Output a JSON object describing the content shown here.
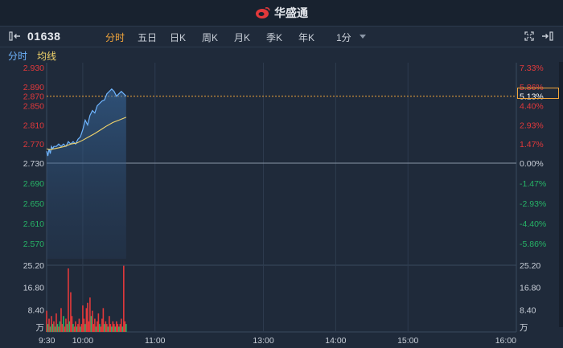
{
  "brand": {
    "name": "华盛通"
  },
  "toolbar": {
    "code": "01638",
    "tabs": [
      "分时",
      "五日",
      "日K",
      "周K",
      "月K",
      "季K",
      "年K",
      "1分"
    ],
    "active_tab": 0
  },
  "legend": {
    "time_label": "分时",
    "avg_label": "均线"
  },
  "colors": {
    "up": "#e2393b",
    "down": "#27b467",
    "price_line": "#6fb5ff",
    "avg_line": "#f2d46b",
    "accent": "#f2a53b",
    "baseline": "#8a96a6"
  },
  "chart_data": {
    "type": "line",
    "prev_close": 2.73,
    "price_ticks_up": [
      "2.930",
      "2.890",
      "2.850",
      "2.810",
      "2.770"
    ],
    "price_tick_base": "2.730",
    "price_ticks_down": [
      "2.690",
      "2.650",
      "2.610",
      "2.570"
    ],
    "pct_ticks_up": [
      "7.33%",
      "5.86%",
      "4.40%",
      "2.93%",
      "1.47%"
    ],
    "pct_tick_base": "0.00%",
    "pct_ticks_down": [
      "-1.47%",
      "-2.93%",
      "-4.40%",
      "-5.86%"
    ],
    "ylim": [
      2.53,
      2.93
    ],
    "crosshair": {
      "price": "2.870",
      "pct": "5.13%"
    },
    "x_ticks": [
      "9:30",
      "10:00",
      "11:00",
      "13:00",
      "14:00",
      "15:00",
      "16:00"
    ],
    "volume_ticks": [
      "25.20",
      "16.80",
      "8.40"
    ],
    "volume_unit": "万",
    "volume_max": 25.2,
    "total_minutes": 390,
    "price": [
      [
        0,
        2.755
      ],
      [
        1,
        2.745
      ],
      [
        2,
        2.76
      ],
      [
        3,
        2.75
      ],
      [
        4,
        2.765
      ],
      [
        5,
        2.76
      ],
      [
        6,
        2.765
      ],
      [
        8,
        2.765
      ],
      [
        10,
        2.77
      ],
      [
        12,
        2.765
      ],
      [
        14,
        2.77
      ],
      [
        16,
        2.765
      ],
      [
        18,
        2.775
      ],
      [
        20,
        2.77
      ],
      [
        22,
        2.775
      ],
      [
        24,
        2.77
      ],
      [
        26,
        2.78
      ],
      [
        28,
        2.785
      ],
      [
        30,
        2.8
      ],
      [
        32,
        2.82
      ],
      [
        34,
        2.81
      ],
      [
        36,
        2.83
      ],
      [
        38,
        2.84
      ],
      [
        40,
        2.835
      ],
      [
        42,
        2.85
      ],
      [
        44,
        2.855
      ],
      [
        46,
        2.86
      ],
      [
        48,
        2.862
      ],
      [
        50,
        2.875
      ],
      [
        52,
        2.88
      ],
      [
        54,
        2.885
      ],
      [
        56,
        2.88
      ],
      [
        58,
        2.87
      ],
      [
        60,
        2.875
      ],
      [
        62,
        2.88
      ],
      [
        64,
        2.875
      ],
      [
        66,
        2.87
      ]
    ],
    "avg": [
      [
        0,
        2.76
      ],
      [
        3,
        2.758
      ],
      [
        6,
        2.76
      ],
      [
        10,
        2.762
      ],
      [
        15,
        2.765
      ],
      [
        20,
        2.77
      ],
      [
        25,
        2.772
      ],
      [
        30,
        2.778
      ],
      [
        35,
        2.785
      ],
      [
        40,
        2.792
      ],
      [
        45,
        2.8
      ],
      [
        50,
        2.808
      ],
      [
        55,
        2.815
      ],
      [
        60,
        2.82
      ],
      [
        66,
        2.826
      ]
    ],
    "volume": [
      [
        0,
        8,
        "up"
      ],
      [
        1,
        3,
        "down"
      ],
      [
        2,
        5,
        "up"
      ],
      [
        3,
        2,
        "down"
      ],
      [
        4,
        6,
        "up"
      ],
      [
        5,
        3,
        "down"
      ],
      [
        6,
        4,
        "up"
      ],
      [
        7,
        2,
        "down"
      ],
      [
        8,
        7,
        "up"
      ],
      [
        9,
        3,
        "down"
      ],
      [
        10,
        2,
        "up"
      ],
      [
        11,
        4,
        "down"
      ],
      [
        12,
        9,
        "up"
      ],
      [
        13,
        3,
        "up"
      ],
      [
        14,
        6,
        "down"
      ],
      [
        15,
        2,
        "up"
      ],
      [
        16,
        5,
        "up"
      ],
      [
        17,
        3,
        "down"
      ],
      [
        18,
        24,
        "up"
      ],
      [
        19,
        4,
        "down"
      ],
      [
        20,
        15,
        "up"
      ],
      [
        21,
        6,
        "up"
      ],
      [
        22,
        3,
        "down"
      ],
      [
        23,
        2,
        "up"
      ],
      [
        24,
        4,
        "up"
      ],
      [
        25,
        2,
        "down"
      ],
      [
        26,
        3,
        "up"
      ],
      [
        27,
        5,
        "up"
      ],
      [
        28,
        2,
        "down"
      ],
      [
        29,
        3,
        "up"
      ],
      [
        30,
        10,
        "up"
      ],
      [
        31,
        5,
        "up"
      ],
      [
        32,
        3,
        "down"
      ],
      [
        33,
        9,
        "up"
      ],
      [
        34,
        11,
        "up"
      ],
      [
        35,
        4,
        "up"
      ],
      [
        36,
        13,
        "up"
      ],
      [
        37,
        6,
        "down"
      ],
      [
        38,
        8,
        "up"
      ],
      [
        39,
        3,
        "up"
      ],
      [
        40,
        5,
        "up"
      ],
      [
        41,
        2,
        "down"
      ],
      [
        42,
        4,
        "up"
      ],
      [
        43,
        7,
        "up"
      ],
      [
        44,
        3,
        "down"
      ],
      [
        45,
        2,
        "up"
      ],
      [
        46,
        5,
        "up"
      ],
      [
        47,
        9,
        "up"
      ],
      [
        48,
        3,
        "down"
      ],
      [
        49,
        4,
        "up"
      ],
      [
        50,
        3,
        "up"
      ],
      [
        51,
        2,
        "down"
      ],
      [
        52,
        6,
        "up"
      ],
      [
        53,
        3,
        "up"
      ],
      [
        54,
        2,
        "down"
      ],
      [
        55,
        4,
        "up"
      ],
      [
        56,
        3,
        "up"
      ],
      [
        57,
        2,
        "down"
      ],
      [
        58,
        4,
        "up"
      ],
      [
        59,
        3,
        "up"
      ],
      [
        60,
        2,
        "down"
      ],
      [
        61,
        3,
        "up"
      ],
      [
        62,
        5,
        "up"
      ],
      [
        63,
        2,
        "down"
      ],
      [
        64,
        25,
        "up"
      ],
      [
        65,
        4,
        "up"
      ],
      [
        66,
        3,
        "down"
      ]
    ]
  }
}
